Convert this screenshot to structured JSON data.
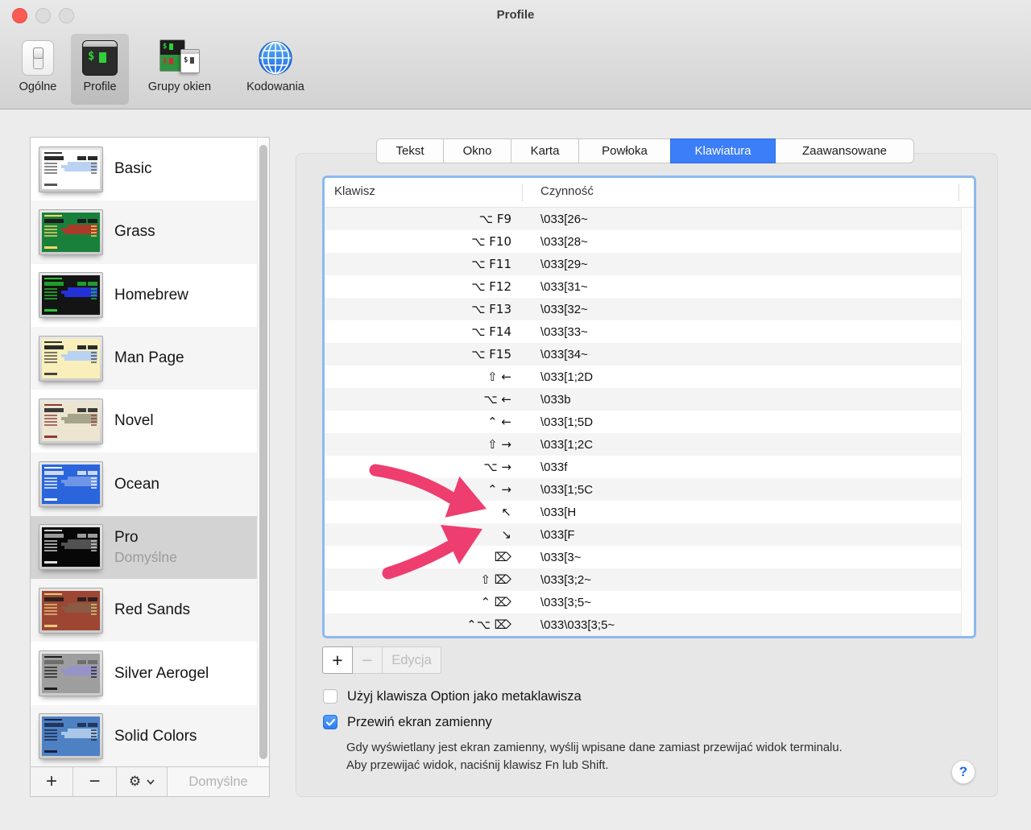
{
  "window": {
    "title": "Profile"
  },
  "colors": {
    "accent_blue": "#3b7ef7",
    "arrow_pink": "#ee3d6f",
    "focus_ring": "#8cb9f0",
    "close_button": "#fc5b53"
  },
  "toolbar": {
    "items": [
      {
        "id": "general",
        "label": "Ogólne",
        "icon": "toggle-switch-icon",
        "selected": false
      },
      {
        "id": "profiles",
        "label": "Profile",
        "icon": "terminal-icon",
        "selected": true
      },
      {
        "id": "window-groups",
        "label": "Grupy okien",
        "icon": "window-group-icon",
        "selected": false
      },
      {
        "id": "encodings",
        "label": "Kodowania",
        "icon": "globe-icon",
        "selected": false
      }
    ]
  },
  "sidebar": {
    "profiles": [
      {
        "name": "Basic",
        "thumb": {
          "bg": "#ffffff",
          "fg": "#555555",
          "hl": "#b9d2f1",
          "title": "#333333",
          "chip": "#2a2a2a"
        }
      },
      {
        "name": "Grass",
        "thumb": {
          "bg": "#19803c",
          "fg": "#ffd863",
          "hl": "#a83b2a",
          "title": "#ffd863",
          "chip": "#1c1c1c"
        }
      },
      {
        "name": "Homebrew",
        "thumb": {
          "bg": "#141414",
          "fg": "#2bc434",
          "hl": "#2531d8",
          "title": "#2bc434",
          "chip": "#1f9e28"
        }
      },
      {
        "name": "Man Page",
        "thumb": {
          "bg": "#f9efba",
          "fg": "#444444",
          "hl": "#b9d2f1",
          "title": "#333333",
          "chip": "#2a2a2a"
        }
      },
      {
        "name": "Novel",
        "thumb": {
          "bg": "#ece5cf",
          "fg": "#8b3a3a",
          "hl": "#a8a489",
          "title": "#8b3a3a",
          "chip": "#3a3a3a"
        }
      },
      {
        "name": "Ocean",
        "thumb": {
          "bg": "#2a65dc",
          "fg": "#ffffff",
          "hl": "#6f95e6",
          "title": "#ffffff",
          "chip": "#cfd9f2"
        }
      },
      {
        "name": "Pro",
        "subtitle": "Domyślne",
        "selected": true,
        "thumb": {
          "bg": "#070707",
          "fg": "#dedede",
          "hl": "#515151",
          "title": "#cfcfcf",
          "chip": "#9a9a9a"
        }
      },
      {
        "name": "Red Sands",
        "thumb": {
          "bg": "#9c4633",
          "fg": "#e8c87c",
          "hl": "#8a5a43",
          "title": "#e8c87c",
          "chip": "#2e2020"
        }
      },
      {
        "name": "Silver Aerogel",
        "thumb": {
          "bg": "#9e9e9e",
          "fg": "#1c1c1c",
          "hl": "#9693c8",
          "title": "#1c1c1c",
          "chip": "#6e6e6e"
        }
      },
      {
        "name": "Solid Colors",
        "thumb": {
          "bg": "#4e80c4",
          "fg": "#16213a",
          "hl": "#a9c6e8",
          "title": "#16213a",
          "chip": "#22365c"
        }
      }
    ],
    "footer": {
      "add": "+",
      "remove": "−",
      "default_label": "Domyślne"
    }
  },
  "tabs": {
    "items": [
      {
        "label": "Tekst"
      },
      {
        "label": "Okno"
      },
      {
        "label": "Karta"
      },
      {
        "label": "Powłoka"
      },
      {
        "label": "Klawiatura",
        "selected": true
      },
      {
        "label": "Zaawansowane"
      }
    ]
  },
  "table": {
    "columns": [
      "Klawisz",
      "Czynność"
    ],
    "rows": [
      {
        "key": "⌥ F9",
        "action": "\\033[26~"
      },
      {
        "key": "⌥ F10",
        "action": "\\033[28~"
      },
      {
        "key": "⌥ F11",
        "action": "\\033[29~"
      },
      {
        "key": "⌥ F12",
        "action": "\\033[31~"
      },
      {
        "key": "⌥ F13",
        "action": "\\033[32~"
      },
      {
        "key": "⌥ F14",
        "action": "\\033[33~"
      },
      {
        "key": "⌥ F15",
        "action": "\\033[34~"
      },
      {
        "key": "⇧ ←",
        "action": "\\033[1;2D"
      },
      {
        "key": "⌥ ←",
        "action": "\\033b"
      },
      {
        "key": "⌃ ←",
        "action": "\\033[1;5D"
      },
      {
        "key": "⇧ →",
        "action": "\\033[1;2C"
      },
      {
        "key": "⌥ →",
        "action": "\\033f"
      },
      {
        "key": "⌃ →",
        "action": "\\033[1;5C"
      },
      {
        "key": "↖",
        "action": "\\033[H"
      },
      {
        "key": "↘",
        "action": "\\033[F"
      },
      {
        "key": "⌦",
        "action": "\\033[3~"
      },
      {
        "key": "⇧ ⌦",
        "action": "\\033[3;2~"
      },
      {
        "key": "⌃ ⌦",
        "action": "\\033[3;5~"
      },
      {
        "key": "⌃⌥ ⌦",
        "action": "\\033\\033[3;5~"
      }
    ]
  },
  "actions": {
    "add": "+",
    "remove": "−",
    "edit": "Edycja"
  },
  "checkboxes": [
    {
      "label": "Użyj klawisza Option jako metaklawisza",
      "checked": false
    },
    {
      "label": "Przewiń ekran zamienny",
      "checked": true
    }
  ],
  "help": {
    "line1": "Gdy wyświetlany jest ekran zamienny, wyślij wpisane dane zamiast przewijać widok terminalu.",
    "line2": "Aby przewijać widok, naciśnij klawisz Fn lub Shift.",
    "button_label": "?"
  }
}
